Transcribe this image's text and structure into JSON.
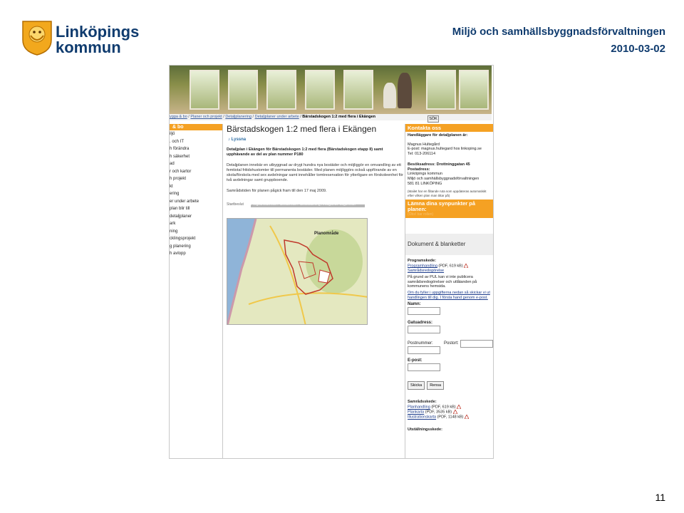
{
  "slide": {
    "logo_line1": "Linköpings",
    "logo_line2": "kommun",
    "organisation": "Miljö och samhällsbyggnadsförvaltningen",
    "date": "2010-03-02",
    "page_number": "11"
  },
  "colors": {
    "accent_orange": "#f5a123",
    "logo_blue": "#0f3b6e",
    "map_outline": "#c0392b"
  },
  "breadcrumb": {
    "items": [
      "ygga & bo",
      "Planer och projekt",
      "Detaljplanering",
      "Detaljplaner under arbete"
    ],
    "current": "Bärstadskogen 1:2 med flera i Ekängen"
  },
  "search_button": "SÖK",
  "nav": {
    "head": "& bo",
    "items": [
      "iljö",
      ". och IT",
      "h förändra",
      "h säkerhet",
      "ad",
      "r och kartor",
      "h projekt",
      "kt",
      "ering",
      "er under arbete",
      "plan blir till",
      "detaljplaner",
      "ark",
      "ning",
      "cklingsprojekt",
      "g planering",
      "h avlopp"
    ]
  },
  "main": {
    "title": "Bärstadskogen 1:2 med flera i Ekängen",
    "listen": "Lyssna",
    "intro": "Detaljplan i Ekängen för Bärstadskogen 1:2 med flera (Bärstadskogen etapp II) samt upphävande av del av plan nummer P180",
    "description": "Detaljplanen innebär en utbyggnad av drygt hundra nya bostäder och möjliggör en omvandling av ett femtiotal fritidshustomter till permanenta bostäder. Med planen möjliggörs också uppförande av en skola/förskola med sex avdelningar samt innehåller tomtreservation för ytterligare en förskoleenhet för två avdelningar samt gruppboende.",
    "consultation": "Samrådstiden för planen pågick fram till den 17 maj 2009.",
    "timeline_start": "Startbeslut",
    "timeline_steps": "Programsamråd Plansamråd Planutställning Antagande Laga kraft",
    "map_label": "Planområde"
  },
  "contact": {
    "head": "Kontakta oss",
    "role": "Handläggare för detaljplanen är:",
    "name": "Magnus Hultegård",
    "email": "E-post: magnus.hultegard hos linkoping.se",
    "phone": "Tel: 013-206114",
    "visit": "Besöksadress: Drottninggatan 45",
    "postal_head": "Postadress:",
    "postal1": "Linköpings kommun",
    "postal2": "Miljö och samhällsbyggnadsförvaltningen",
    "postal3": "581 81  LINKÖPING",
    "note": "(Mailet har en fåtande ruta som uppdateras automatiskt efter vilken plan man tittar på)"
  },
  "feedback": {
    "title": "Lämna dina synpunkter på planen:",
    "subtitle": "(Obs! bar rollen)"
  },
  "documents": {
    "head": "Dokument & blanketter",
    "program_head": "Programskede:",
    "program_items": [
      {
        "label": "Programhandling",
        "meta": "(PDF, 619 kB)"
      },
      {
        "label": "Samrådsredogörelse",
        "meta": ""
      }
    ],
    "pul_note": "På grund av PUL kan vi inte publicera samrådsredogörelser och utlåtanden på kommunens hemsida.",
    "pul_link": "Om du fyller i uppgifterna nedan så skickar vi ut handlingen till dig. I första hand genom e-post.",
    "field_name": "Namn:",
    "field_street": "Gatuadress:",
    "field_postal": "Postnummer:",
    "field_city": "Postort:",
    "field_email": "E-post:",
    "send": "Skicka",
    "clear": "Rensa",
    "consult_head": "Samrådsskede:",
    "consult_items": [
      {
        "label": "Planhandling",
        "meta": "(PDF, 619 kB)"
      },
      {
        "label": "Plankarta",
        "meta": "(PDF, 3535 kB)"
      },
      {
        "label": "Illustrationskarta",
        "meta": "(PDF, 1148 kB)"
      }
    ],
    "exhibit_head": "Utställningsskede:"
  }
}
